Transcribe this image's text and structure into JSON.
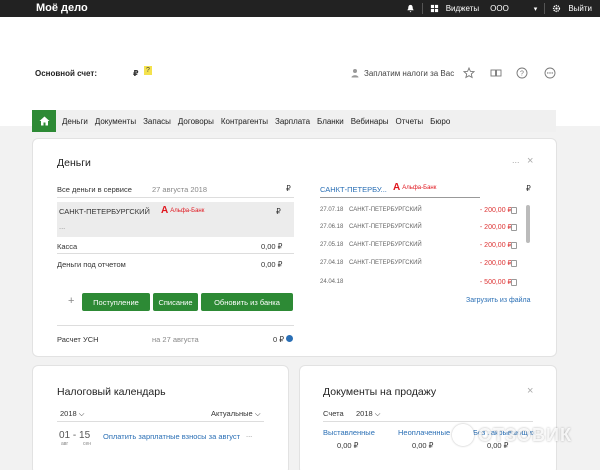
{
  "topbar": {
    "logo": "Моё дело",
    "widgets": "Виджеты",
    "company": "ООО",
    "logout": "Выйти"
  },
  "header": {
    "account_label": "Основной счет:",
    "account_currency": "₽",
    "account_hint": "?",
    "tax_service": "Заплатим налоги за Вас"
  },
  "nav": {
    "items": [
      "Деньги",
      "Документы",
      "Запасы",
      "Договоры",
      "Контрагенты",
      "Зарплата",
      "Бланки",
      "Вебинары",
      "Отчеты",
      "Бюро"
    ]
  },
  "money": {
    "title": "Деньги",
    "minimize": "...",
    "close": "×",
    "all_money_label": "Все деньги в сервисе",
    "all_money_date": "27 августа 2018",
    "all_money_currency": "₽",
    "bank_name": "САНКТ-ПЕТЕРБУРГСКИЙ",
    "bank_brand": "Альфа-Банк",
    "bank_currency": "₽",
    "bank_dots": "...",
    "cash_label": "Касса",
    "cash_value": "0,00 ₽",
    "report_label": "Деньги под отчетом",
    "report_value": "0,00 ₽",
    "btn_income": "Поступление",
    "btn_outcome": "Списание",
    "btn_update": "Обновить из банка",
    "plus": "+",
    "usn_label": "Расчет УСН",
    "usn_date": "на 27 августа",
    "usn_value": "0 ₽",
    "right_bank": "САНКТ-ПЕТЕРБУ...",
    "right_brand": "Альфа-Банк",
    "right_currency": "₽",
    "transactions": [
      {
        "date": "27.07.18",
        "name": "САНКТ-ПЕТЕРБУРГСКИЙ",
        "amount": "- 200,00 ₽"
      },
      {
        "date": "27.06.18",
        "name": "САНКТ-ПЕТЕРБУРГСКИЙ",
        "amount": "- 200,00 ₽"
      },
      {
        "date": "27.05.18",
        "name": "САНКТ-ПЕТЕРБУРГСКИЙ",
        "amount": "- 200,00 ₽"
      },
      {
        "date": "27.04.18",
        "name": "САНКТ-ПЕТЕРБУРГСКИЙ",
        "amount": "- 200,00 ₽"
      },
      {
        "date": "24.04.18",
        "name": "",
        "amount": "- 500,00 ₽"
      }
    ],
    "load_file": "Загрузить из файла"
  },
  "calendar": {
    "title": "Налоговый календарь",
    "year": "2018",
    "filter": "Актуальные",
    "event_dates": "01 - 15",
    "event_month_a": "авг",
    "event_month_b": "сен",
    "event_text": "Оплатить зарплатные взносы за август",
    "event_more": "..."
  },
  "docs": {
    "title": "Документы на продажу",
    "close": "×",
    "type": "Счета",
    "year": "2018",
    "issued_label": "Выставленные",
    "issued_value": "0,00 ₽",
    "unpaid_label": "Неоплаченные",
    "unpaid_value": "0,00 ₽",
    "unclosed_label": "Без закрывающих",
    "unclosed_value": "0,00 ₽"
  },
  "watermark": "ОТЗОВИК",
  "colors": {
    "topbar": "#222222",
    "accent_green": "#2d8a35",
    "negative_red": "#dd3333",
    "link_blue": "#2a6fb5",
    "alfa_red": "#e0161e"
  }
}
